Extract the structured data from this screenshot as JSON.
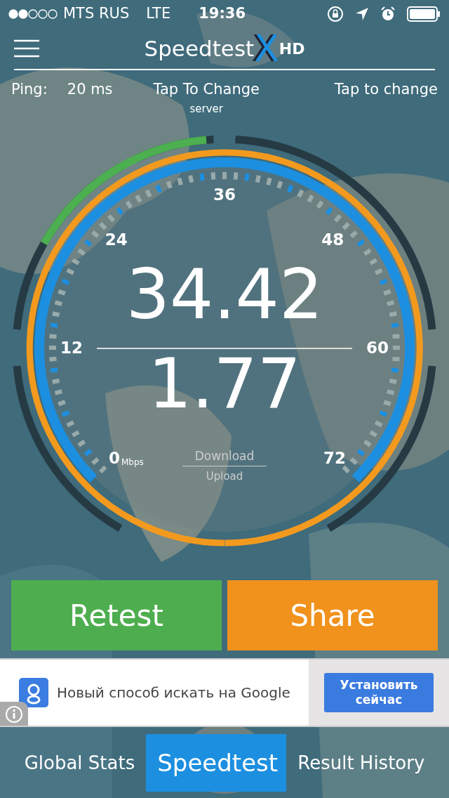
{
  "status_bar": {
    "carrier": "MTS RUS",
    "network": "LTE",
    "time": "19:36"
  },
  "header": {
    "title": "Speedtest",
    "title_mark": "X",
    "title_suffix": "HD"
  },
  "info_row": {
    "ping_label": "Ping:",
    "ping_value": "20 ms",
    "server": "Tap To Change",
    "server_caption": "server",
    "right": "Tap to change"
  },
  "gauge": {
    "ticks": [
      "0",
      "12",
      "24",
      "36",
      "48",
      "60",
      "72"
    ],
    "unit": "Mbps",
    "download": "34.42",
    "upload": "1.77",
    "download_label": "Download",
    "upload_label": "Upload"
  },
  "buttons": [
    {
      "label": "Retest",
      "kind": "retest"
    },
    {
      "label": "Share",
      "kind": "share"
    }
  ],
  "ad": {
    "text": "Новый способ искать на Google",
    "button": "Установить сейчас"
  },
  "tabs": [
    {
      "label": "Global Stats",
      "selected": false
    },
    {
      "label": "Speedtest",
      "selected": true
    },
    {
      "label": "Result History",
      "selected": false
    }
  ]
}
